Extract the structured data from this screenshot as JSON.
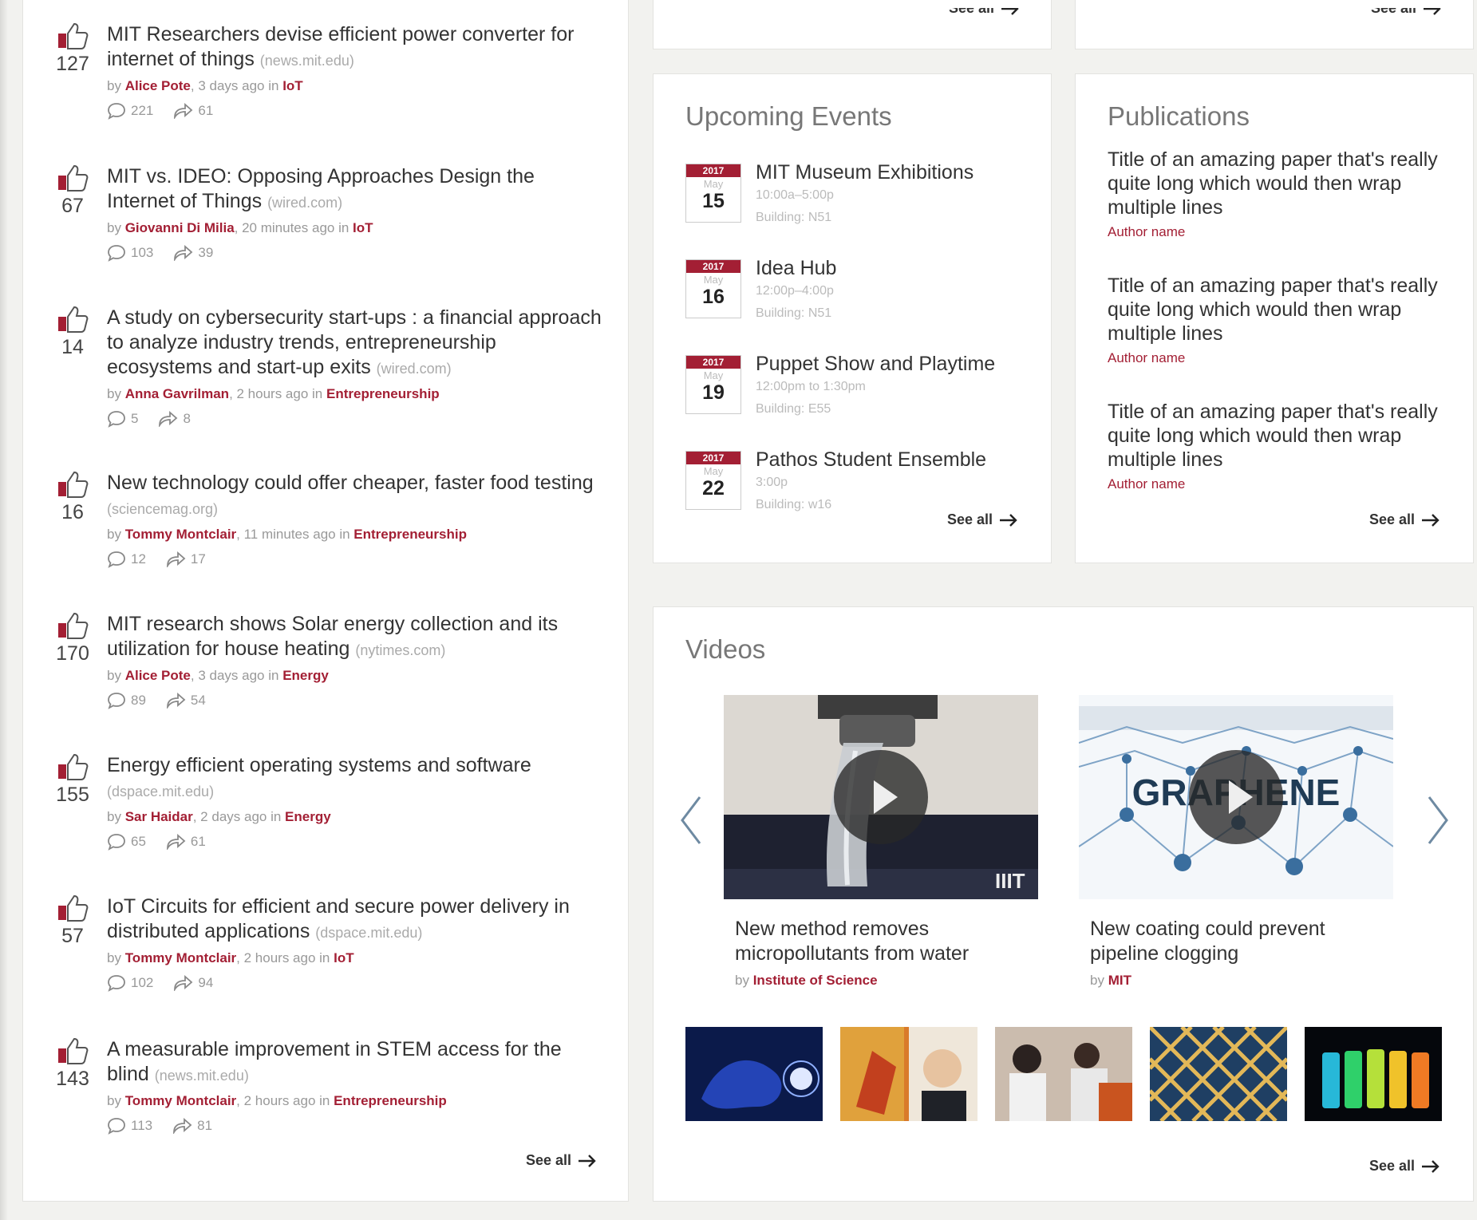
{
  "news": {
    "items": [
      {
        "votes": "127",
        "title": "MIT Researchers devise efficient power converter for internet of things",
        "source": "(news.mit.edu)",
        "by": "by ",
        "author": "Alice Pote",
        "when": ", 3 days ago in ",
        "category": "IoT",
        "comments": "221",
        "shares": "61"
      },
      {
        "votes": "67",
        "title": "MIT vs. IDEO: Opposing Approaches Design the Internet of Things",
        "source": "(wired.com)",
        "by": "by ",
        "author": "Giovanni Di Milia",
        "when": ", 20 minutes ago in ",
        "category": "IoT",
        "comments": "103",
        "shares": "39"
      },
      {
        "votes": "14",
        "title": "A study on cybersecurity start-ups : a financial approach to analyze industry trends, entrepreneurship ecosystems and start-up exits",
        "source": "(wired.com)",
        "by": "by ",
        "author": "Anna Gavrilman",
        "when": ", 2 hours ago in ",
        "category": "Entrepreneurship",
        "comments": "5",
        "shares": "8"
      },
      {
        "votes": "16",
        "title": "New technology could offer cheaper, faster food testing",
        "source": "(sciencemag.org)",
        "by": "by ",
        "author": "Tommy Montclair",
        "when": ", 11 minutes ago in ",
        "category": "Entrepreneurship",
        "comments": "12",
        "shares": "17"
      },
      {
        "votes": "170",
        "title": "MIT research shows Solar energy collection and its utilization for house heating",
        "source": "(nytimes.com)",
        "by": "by ",
        "author": "Alice Pote",
        "when": ", 3 days ago in ",
        "category": "Energy",
        "comments": "89",
        "shares": "54"
      },
      {
        "votes": "155",
        "title": "Energy efficient operating systems and software",
        "source": "(dspace.mit.edu)",
        "by": "by ",
        "author": "Sar Haidar",
        "when": ", 2 days ago in ",
        "category": "Energy",
        "comments": "65",
        "shares": "61"
      },
      {
        "votes": "57",
        "title": "IoT Circuits for efficient and secure power delivery in distributed applications",
        "source": "(dspace.mit.edu)",
        "by": "by ",
        "author": "Tommy Montclair",
        "when": ", 2 hours ago in ",
        "category": "IoT",
        "comments": "102",
        "shares": "94"
      },
      {
        "votes": "143",
        "title": "A measurable improvement in STEM access for the blind",
        "source": "(news.mit.edu)",
        "by": "by ",
        "author": "Tommy Montclair",
        "when": ", 2 hours ago in ",
        "category": "Entrepreneurship",
        "comments": "113",
        "shares": "81"
      }
    ],
    "see_all": "See all"
  },
  "stubs": {
    "events_see_all": "See all",
    "pubs_see_all": "See all"
  },
  "events": {
    "title": "Upcoming Events",
    "items": [
      {
        "year": "2017",
        "month": "May",
        "day": "15",
        "name": "MIT Museum Exhibitions",
        "time": "10:00a–5:00p",
        "building": "Building: N51"
      },
      {
        "year": "2017",
        "month": "May",
        "day": "16",
        "name": "Idea Hub",
        "time": "12:00p–4:00p",
        "building": "Building: N51"
      },
      {
        "year": "2017",
        "month": "May",
        "day": "19",
        "name": "Puppet Show and Playtime",
        "time": "12:00pm to 1:30pm",
        "building": "Building: E55"
      },
      {
        "year": "2017",
        "month": "May",
        "day": "22",
        "name": "Pathos Student Ensemble",
        "time": "3:00p",
        "building": "Building: w16"
      }
    ],
    "see_all": "See all"
  },
  "publications": {
    "title": "Publications",
    "items": [
      {
        "title": "Title of an amazing paper that's really quite long which would then wrap multiple lines",
        "author": "Author name"
      },
      {
        "title": "Title of an amazing paper that's really quite long which would then wrap multiple lines",
        "author": "Author name"
      },
      {
        "title": "Title of an amazing paper that's really quite long which would then wrap multiple lines",
        "author": "Author name"
      }
    ],
    "see_all": "See all"
  },
  "videos": {
    "title": "Videos",
    "items": [
      {
        "title": "New method removes micropollutants from water",
        "by": "by ",
        "author": "Institute of Science"
      },
      {
        "title": "New coating could prevent pipeline clogging",
        "by": "by ",
        "author": "MIT",
        "thumb_text": "GRAPHENE"
      }
    ],
    "see_all": "See all"
  },
  "colors": {
    "accent": "#a31f34",
    "background": "#f2f2ef"
  }
}
